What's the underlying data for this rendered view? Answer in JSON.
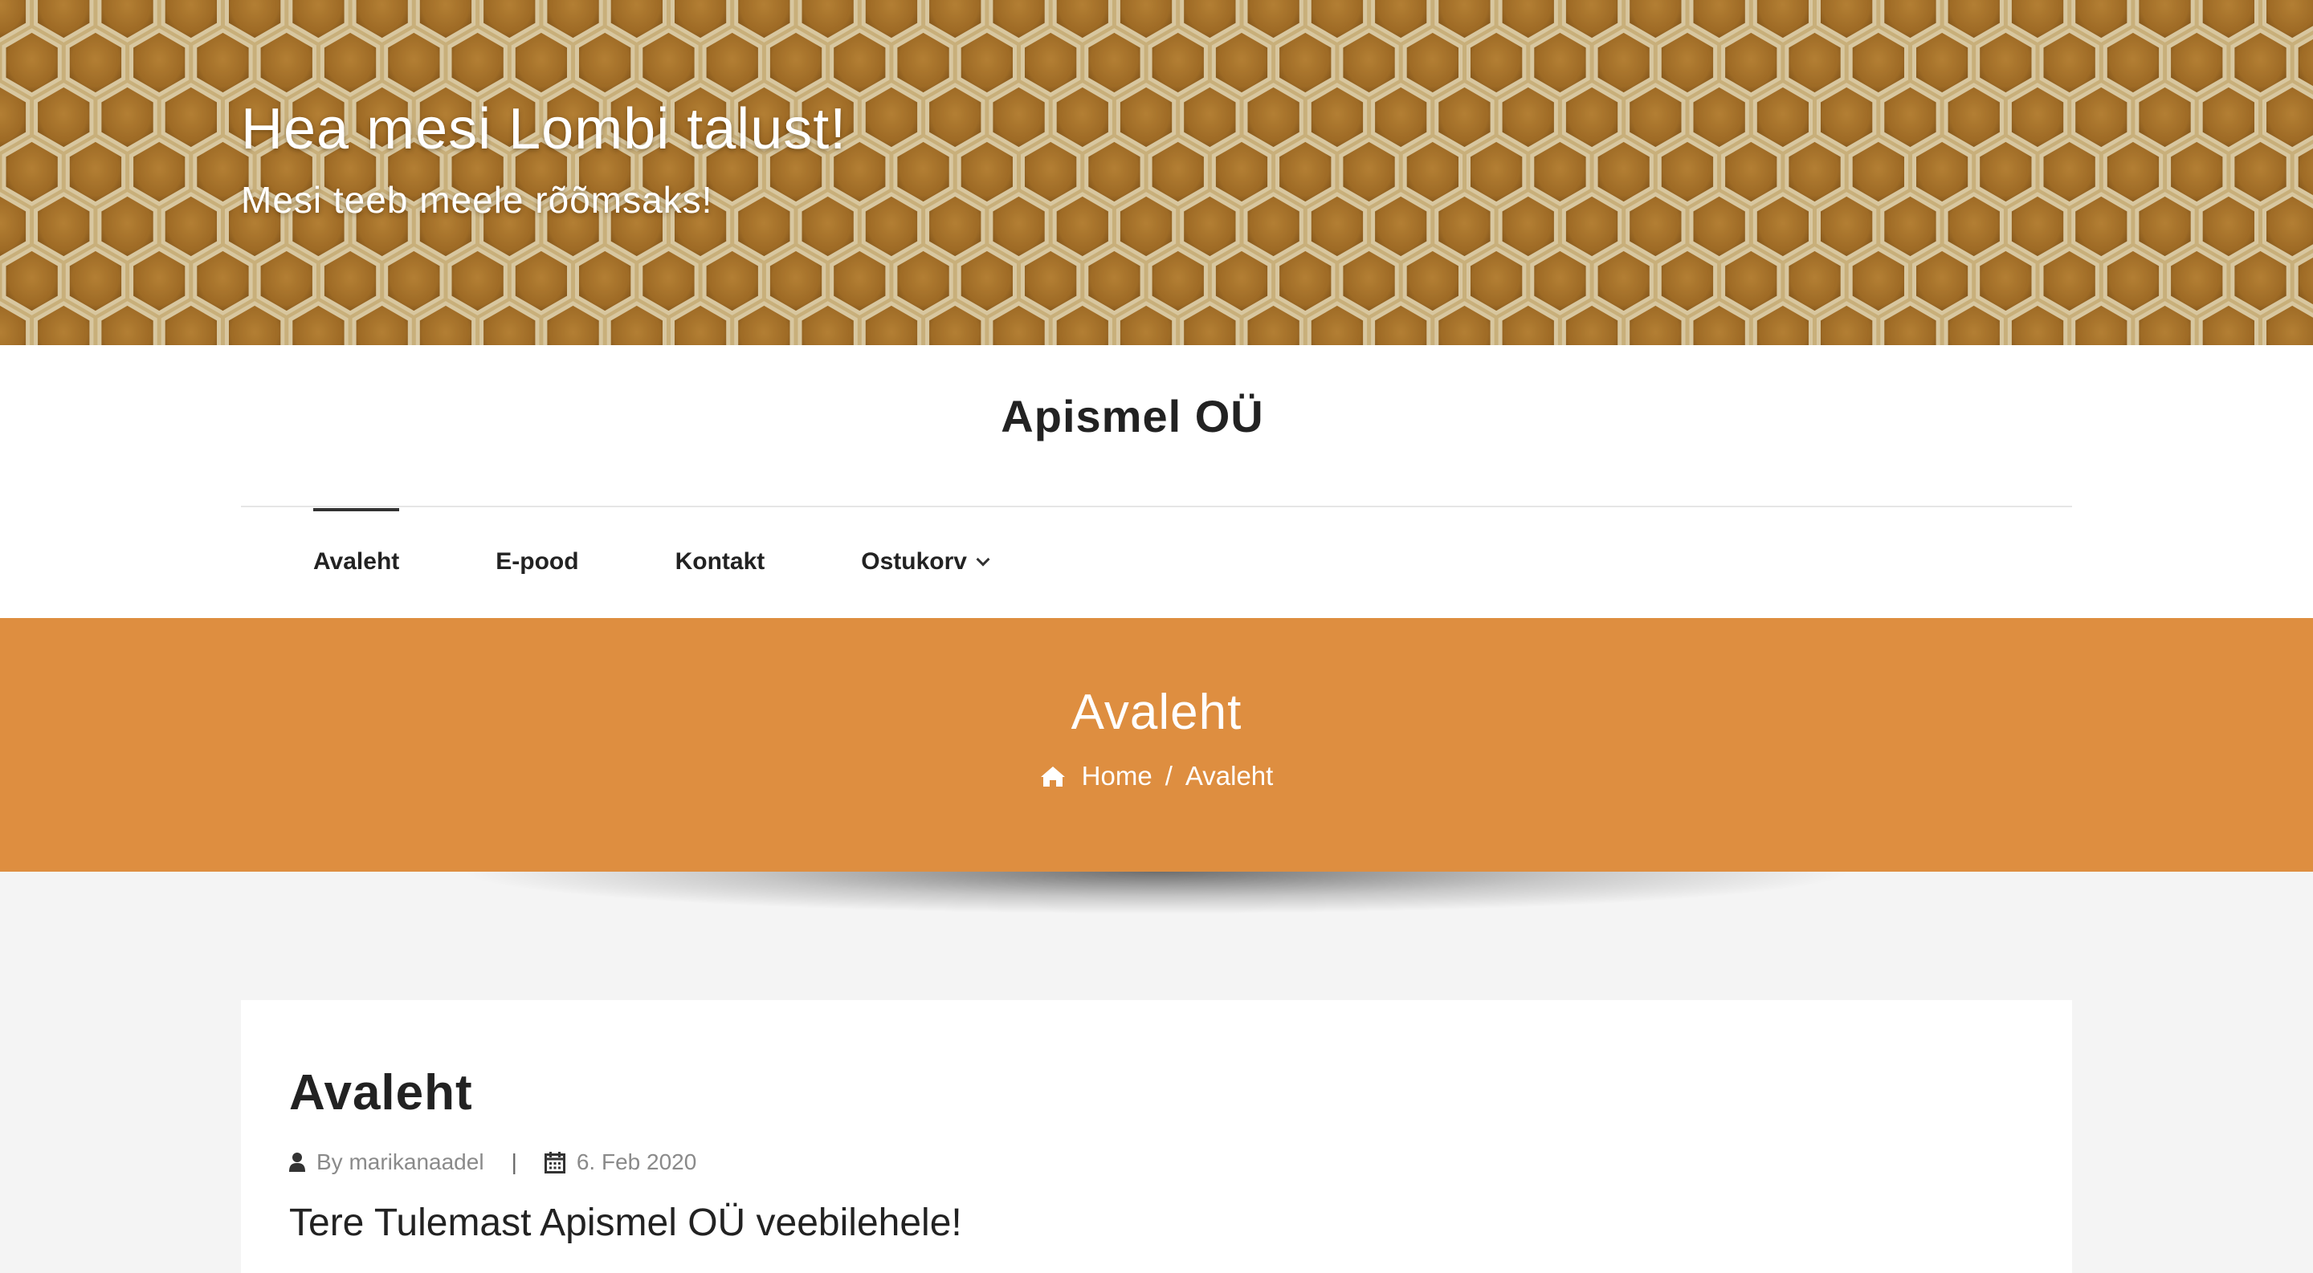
{
  "hero": {
    "title": "Hea mesi Lombi talust!",
    "subtitle": "Mesi teeb meele rõõmsaks!"
  },
  "site": {
    "name": "Apismel OÜ"
  },
  "nav": {
    "items": [
      {
        "label": "Avaleht",
        "active": true
      },
      {
        "label": "E-pood",
        "active": false
      },
      {
        "label": "Kontakt",
        "active": false
      },
      {
        "label": "Ostukorv",
        "active": false,
        "dropdown": true
      }
    ]
  },
  "page_banner": {
    "title": "Avaleht",
    "breadcrumb": {
      "home_icon": "home-icon",
      "home_label": "Home",
      "separator": "/",
      "current": "Avaleht"
    }
  },
  "post": {
    "title": "Avaleht",
    "author_label": "By marikanaadel",
    "meta_separator": "|",
    "date": "6. Feb 2020",
    "lead": "Tere Tulemast Apismel OÜ veebilehele!"
  },
  "colors": {
    "banner_orange": "#de8e40",
    "honey": "#b98a3c",
    "text_dark": "#222222",
    "meta_gray": "#8a8a8a",
    "page_bg": "#f4f4f4"
  }
}
